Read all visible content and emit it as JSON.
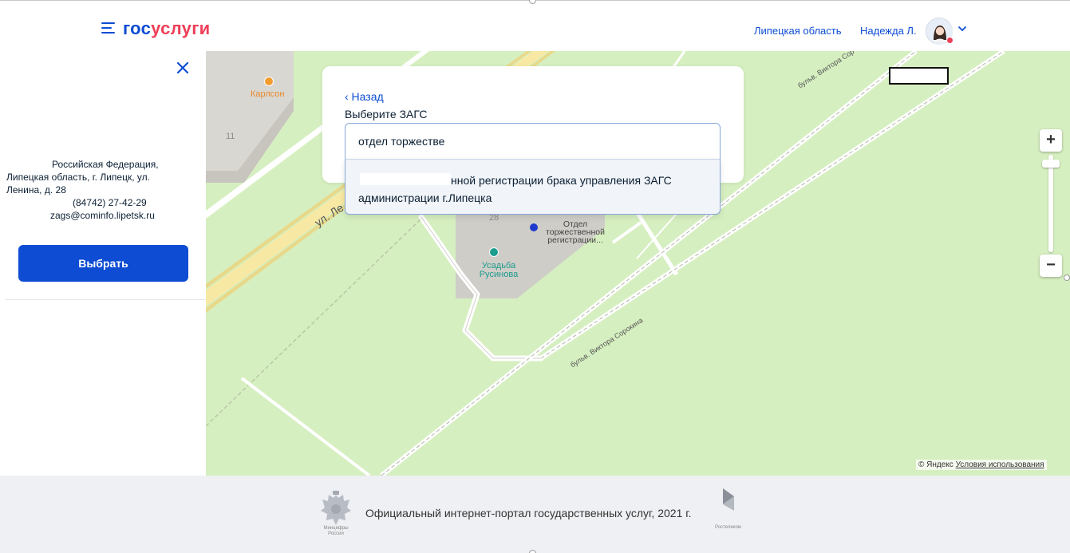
{
  "header": {
    "logo_part1": "гос",
    "logo_part2": "услуги",
    "region": "Липецкая область",
    "user_name": "Надежда Л."
  },
  "sidebar": {
    "address_lines": [
      "Российская Федерация,",
      "Липецкая область, г. Липецк, ул.",
      "Ленина, д. 28",
      "(84742) 27-42-29",
      "zags@cominfo.lipetsk.ru"
    ],
    "choose_label": "Выбрать"
  },
  "search": {
    "back_label": "‹ Назад",
    "title": "Выберите ЗАГС",
    "input_value": "отдел торжестве",
    "result_line1": "нной регистрации брака управления ЗАГС",
    "result_line2": "администрации г.Липецка"
  },
  "map": {
    "poi_karlson": "Карлсон",
    "house_11": "11",
    "house_28": "28",
    "zags_poi": "Отдел торжественной регистрации...",
    "usadba": "Усадьба Русинова",
    "street_lenina": "ул. Ле",
    "boulevard_top": "бульв. Виктора Сор",
    "boulevard_bottom": "бульв. Виктора Сорокина",
    "zoom_plus": "+",
    "zoom_minus": "−",
    "copyright": "© Яндекс",
    "terms_link": "Условия использования"
  },
  "footer": {
    "text": "Официальный интернет-портал государственных услуг, 2021 г.",
    "emblem_caption": "Минцифры России",
    "rostelecom_caption": "Ростелеком"
  },
  "colors": {
    "brand_blue": "#0d4cd3",
    "brand_red": "#ee3f58",
    "map_green": "#d6efc0"
  }
}
